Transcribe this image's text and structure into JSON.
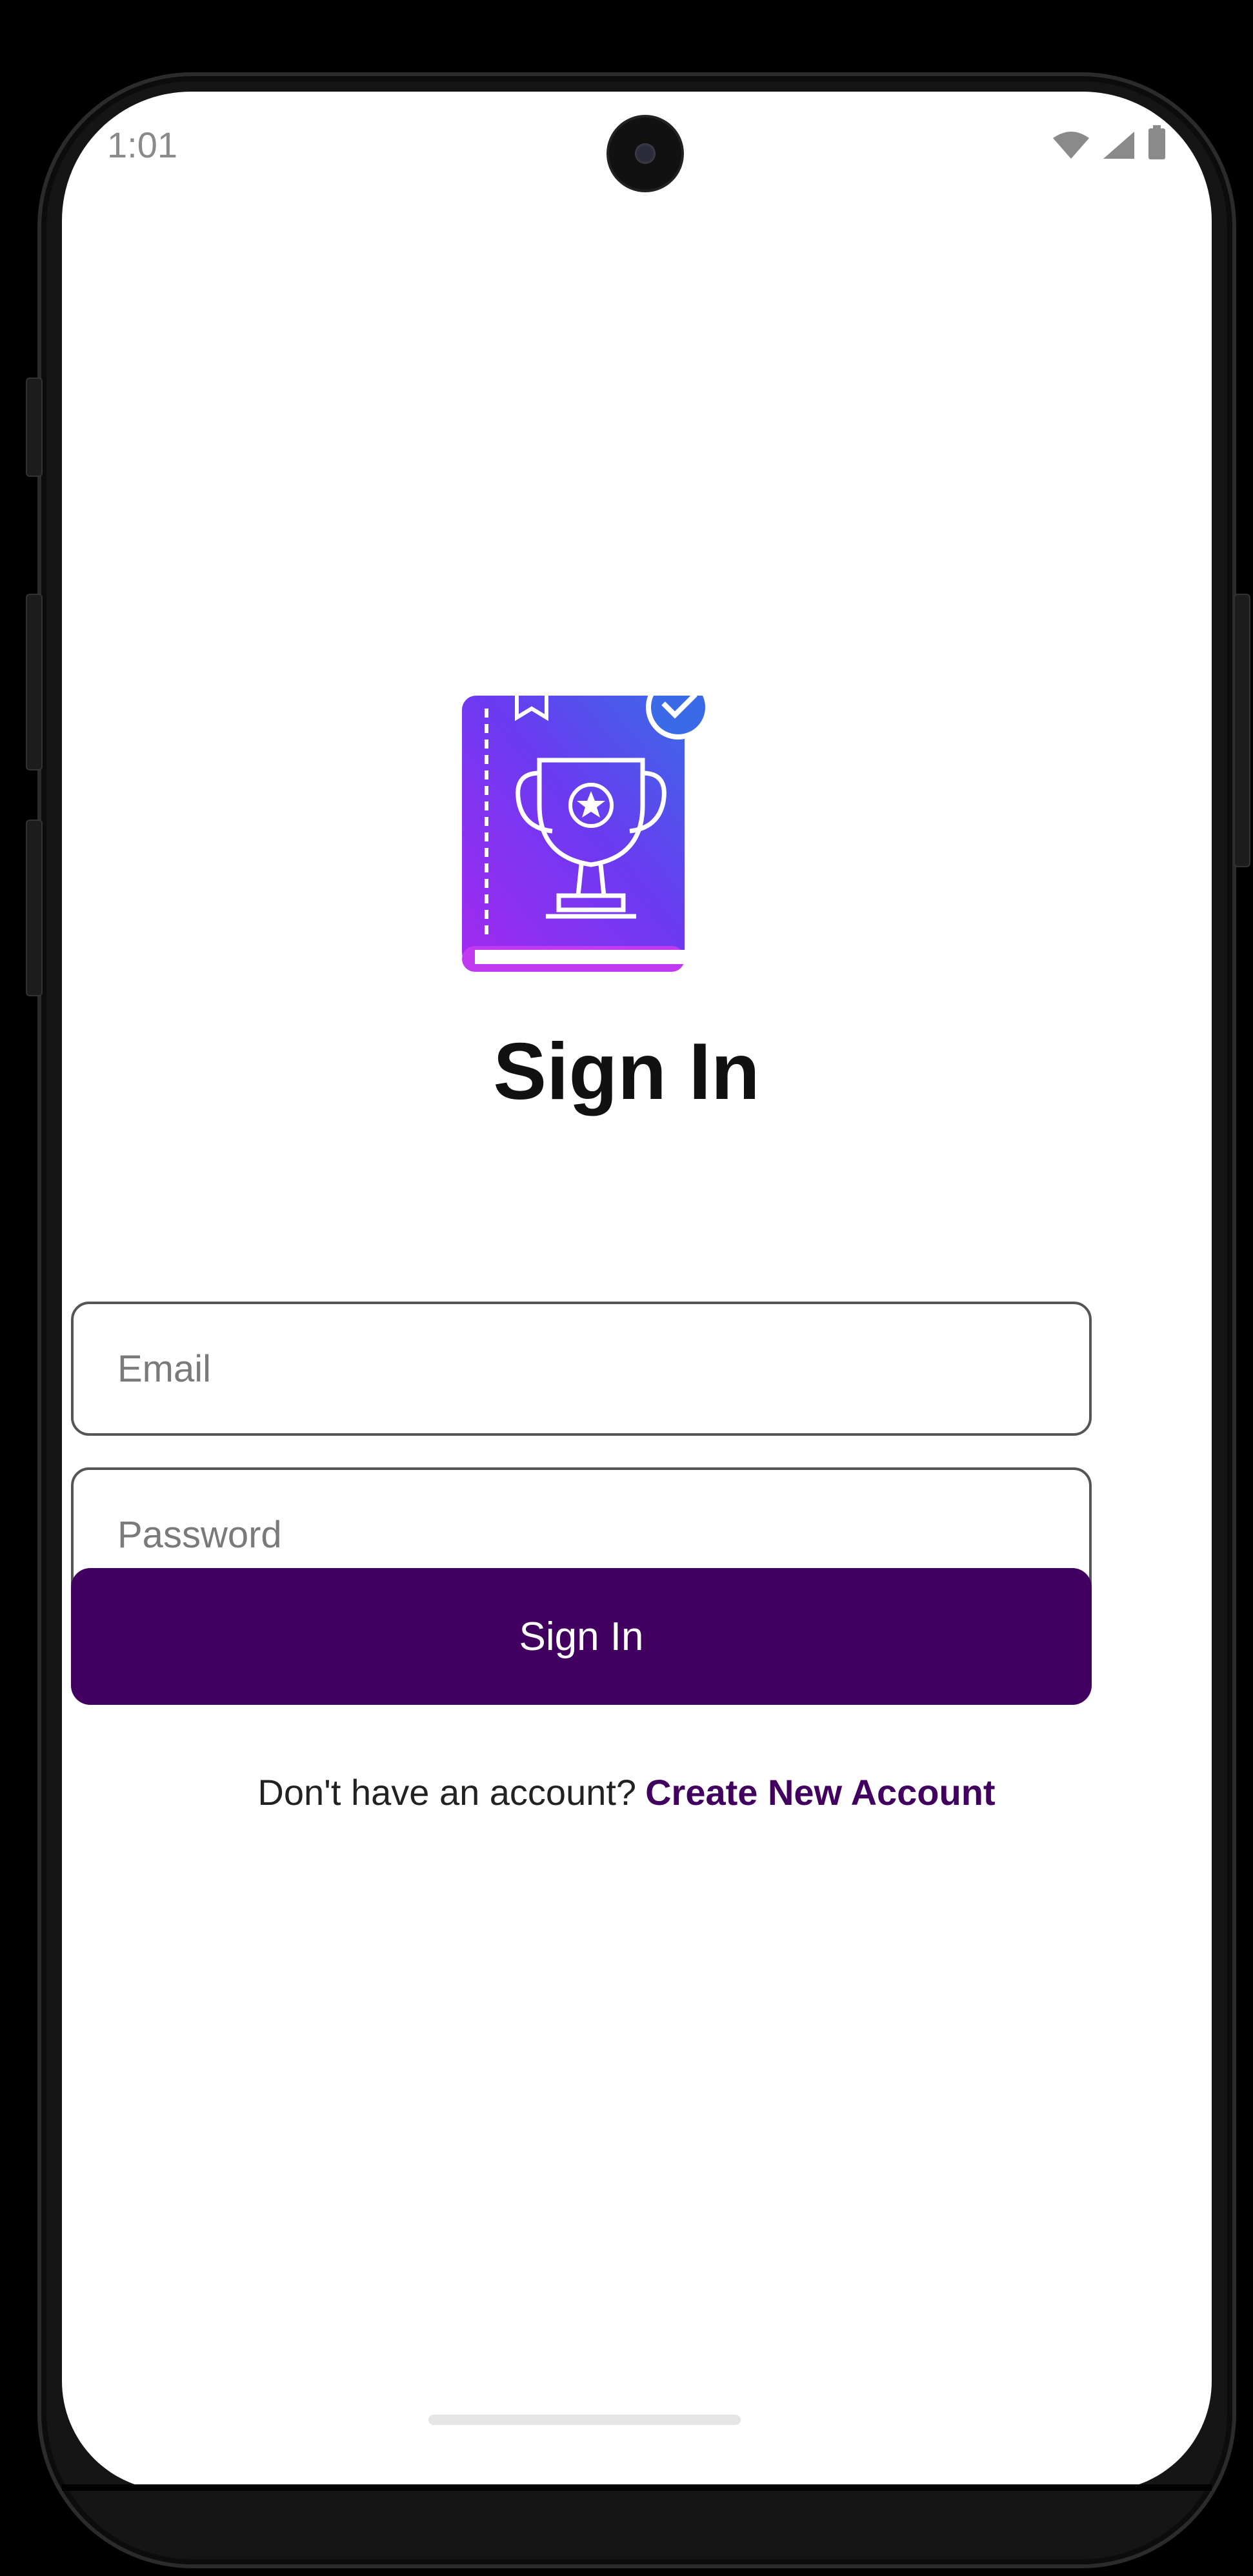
{
  "status_bar": {
    "time": "1:01",
    "icons": [
      "wifi-icon",
      "cell-signal-icon",
      "battery-icon"
    ]
  },
  "logo": {
    "icon": "trophy-book-icon",
    "gradient": [
      "#7b2ff7",
      "#3f6fe8"
    ]
  },
  "signin": {
    "title": "Sign In",
    "email_placeholder": "Email",
    "email_value": "",
    "password_placeholder": "Password",
    "password_value": "",
    "button_label": "Sign In",
    "no_account_text": "Don't have an account?",
    "create_account_link": "Create New Account"
  },
  "colors": {
    "primary": "#41005f",
    "background": "#ffffff"
  }
}
